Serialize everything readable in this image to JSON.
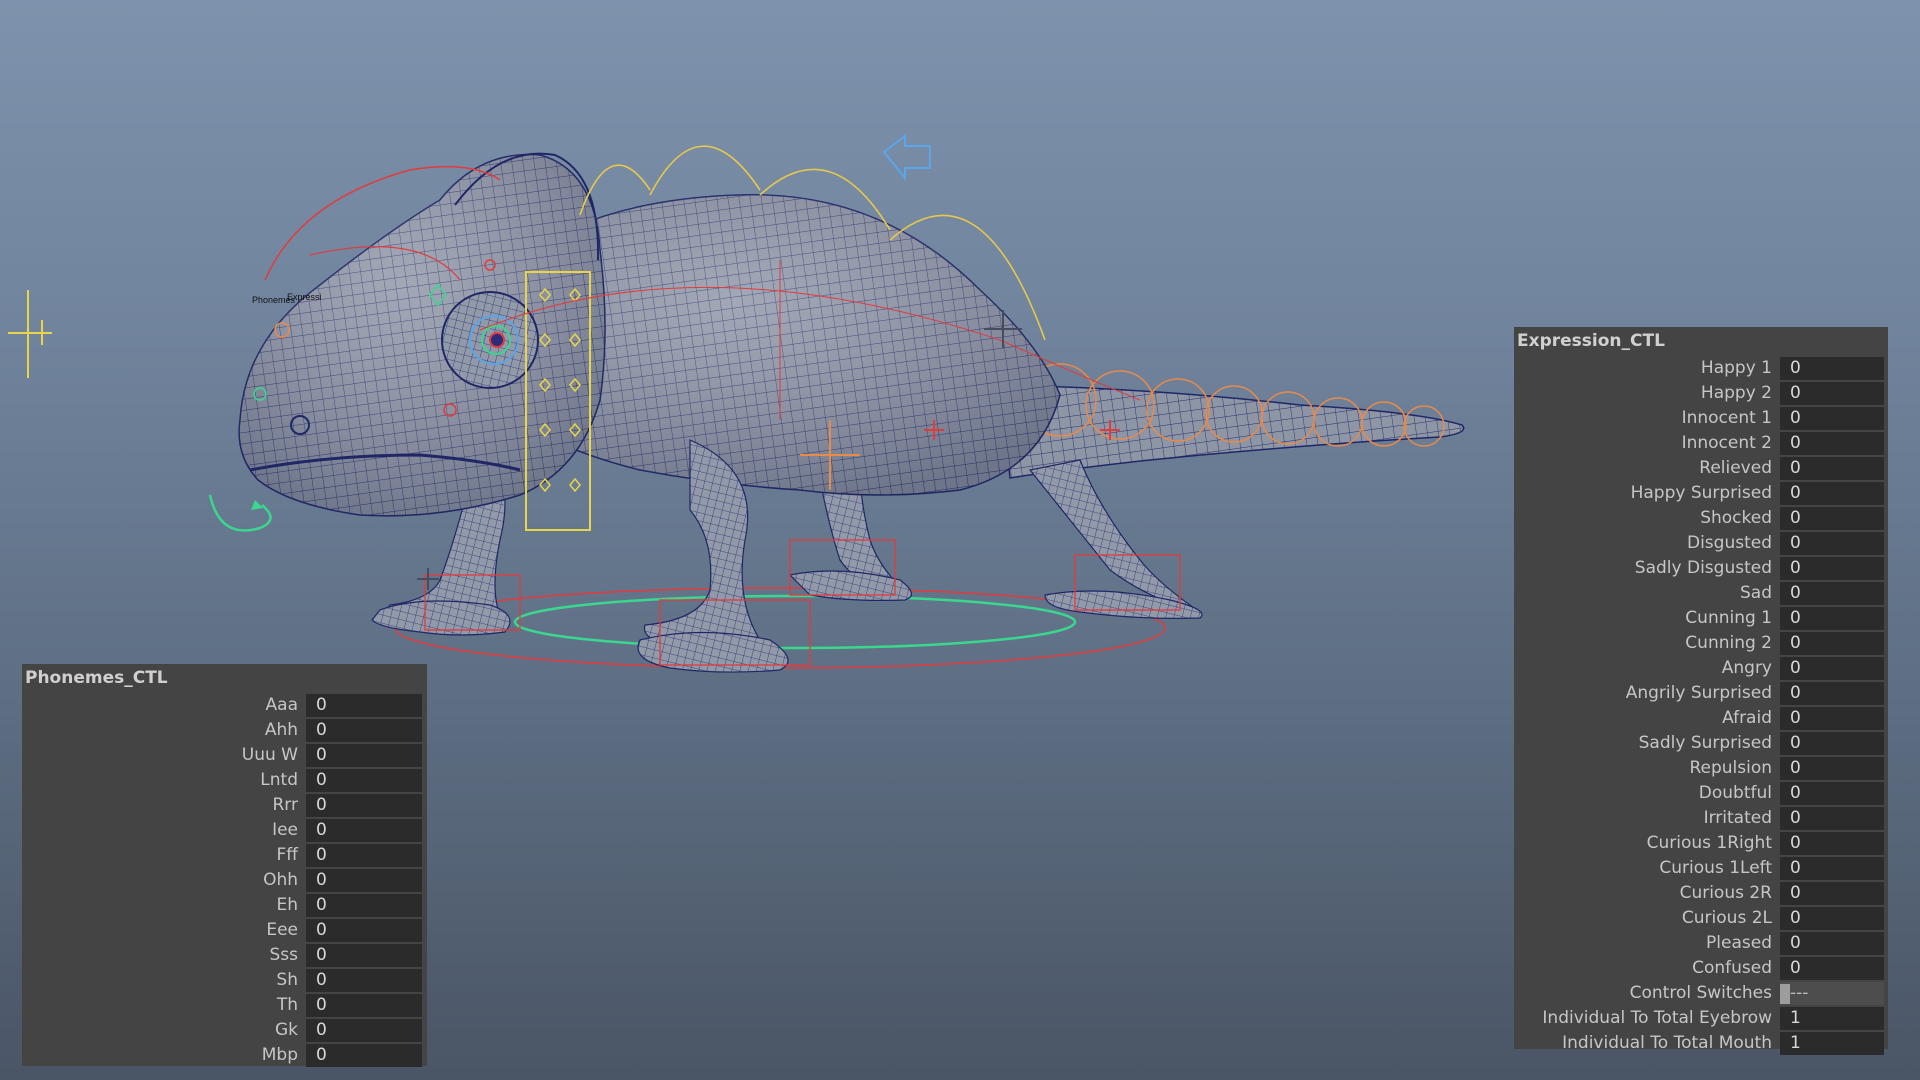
{
  "viewport": {
    "scene": "chameleon-rig",
    "overlay_labels": [
      "Phonemes",
      "Expressi"
    ],
    "colors": {
      "mesh_fill": "#9096a6",
      "wire": "#232c6e",
      "ctrl_red": "#e23b3b",
      "ctrl_orange": "#e88a4a",
      "ctrl_yellow": "#e8c84a",
      "ctrl_green": "#39d88e",
      "ctrl_blue": "#5aa6e8"
    }
  },
  "phonemes_ctl": {
    "title": "Phonemes_CTL",
    "rows": [
      {
        "label": "Aaa",
        "value": "0"
      },
      {
        "label": "Ahh",
        "value": "0"
      },
      {
        "label": "Uuu W",
        "value": "0"
      },
      {
        "label": "Lntd",
        "value": "0"
      },
      {
        "label": "Rrr",
        "value": "0"
      },
      {
        "label": "Iee",
        "value": "0"
      },
      {
        "label": "Fff",
        "value": "0"
      },
      {
        "label": "Ohh",
        "value": "0"
      },
      {
        "label": "Eh",
        "value": "0"
      },
      {
        "label": "Eee",
        "value": "0"
      },
      {
        "label": "Sss",
        "value": "0"
      },
      {
        "label": "Sh",
        "value": "0"
      },
      {
        "label": "Th",
        "value": "0"
      },
      {
        "label": "Gk",
        "value": "0"
      },
      {
        "label": "Mbp",
        "value": "0"
      }
    ]
  },
  "expression_ctl": {
    "title": "Expression_CTL",
    "rows": [
      {
        "label": "Happy 1",
        "value": "0"
      },
      {
        "label": "Happy 2",
        "value": "0"
      },
      {
        "label": "Innocent 1",
        "value": "0"
      },
      {
        "label": "Innocent 2",
        "value": "0"
      },
      {
        "label": "Relieved",
        "value": "0"
      },
      {
        "label": "Happy Surprised",
        "value": "0"
      },
      {
        "label": "Shocked",
        "value": "0"
      },
      {
        "label": "Disgusted",
        "value": "0"
      },
      {
        "label": "Sadly Disgusted",
        "value": "0"
      },
      {
        "label": "Sad",
        "value": "0"
      },
      {
        "label": "Cunning 1",
        "value": "0"
      },
      {
        "label": "Cunning 2",
        "value": "0"
      },
      {
        "label": "Angry",
        "value": "0"
      },
      {
        "label": "Angrily Surprised",
        "value": "0"
      },
      {
        "label": "Afraid",
        "value": "0"
      },
      {
        "label": "Sadly Surprised",
        "value": "0"
      },
      {
        "label": "Repulsion",
        "value": "0"
      },
      {
        "label": "Doubtful",
        "value": "0"
      },
      {
        "label": "Irritated",
        "value": "0"
      },
      {
        "label": "Curious 1Right",
        "value": "0"
      },
      {
        "label": "Curious 1Left",
        "value": "0"
      },
      {
        "label": "Curious 2R",
        "value": "0"
      },
      {
        "label": "Curious 2L",
        "value": "0"
      },
      {
        "label": "Pleased",
        "value": "0"
      },
      {
        "label": "Confused",
        "value": "0"
      },
      {
        "label": "Control Switches",
        "value": "---",
        "switch": true
      },
      {
        "label": "Individual To Total Eyebrow",
        "value": "1"
      },
      {
        "label": "Individual To Total Mouth",
        "value": "1"
      }
    ]
  }
}
